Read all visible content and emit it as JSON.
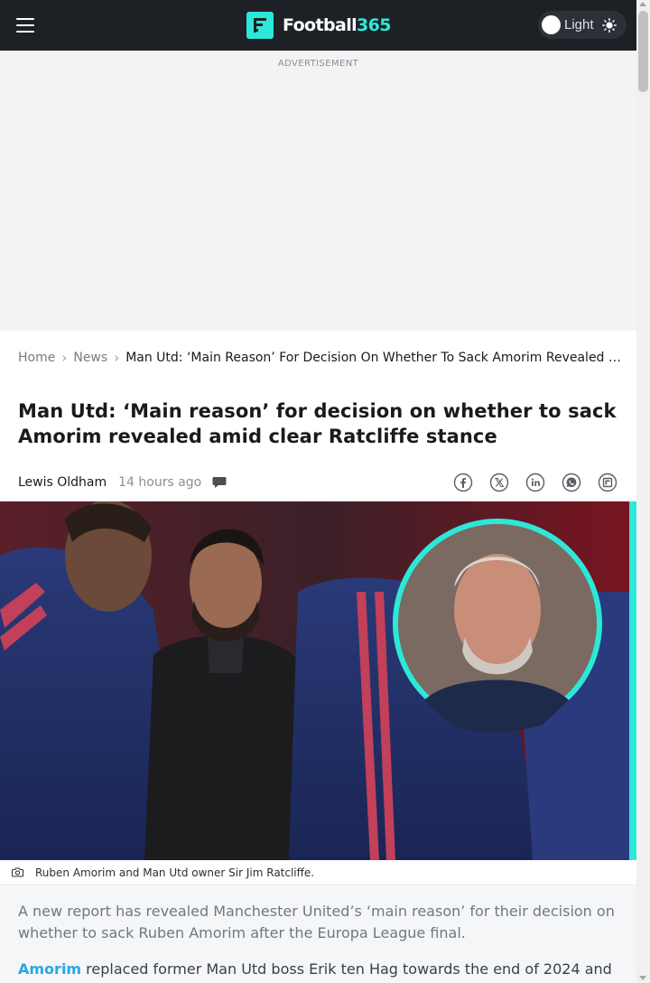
{
  "header": {
    "logo_text": "Football",
    "logo_accent": "365",
    "theme_label": "Light",
    "brand_color": "#2de8d8"
  },
  "ad": {
    "label": "ADVERTISEMENT"
  },
  "breadcrumb": {
    "items": [
      "Home",
      "News"
    ],
    "current": "Man Utd: ‘Main Reason’ For Decision On Whether To Sack Amorim Revealed Amid Clear Ratcliffe Stance"
  },
  "article": {
    "title": "Man Utd: ‘Main reason’ for decision on whether to sack Amorim revealed amid clear Ratcliffe stance",
    "author": "Lewis Oldham",
    "time": "14 hours ago",
    "share_icons": [
      "facebook-icon",
      "x-icon",
      "linkedin-icon",
      "whatsapp-icon",
      "flipboard-icon"
    ],
    "image_caption": "Ruben Amorim and Man Utd owner Sir Jim Ratcliffe.",
    "lead": "A new report has revealed Manchester United’s ‘main reason’ for their decision on whether to sack Ruben Amorim after the Europa League final.",
    "p2_link": "Amorim",
    "p2_text": " replaced former Man Utd boss Erik ten Hag towards the end of 2024 and"
  }
}
